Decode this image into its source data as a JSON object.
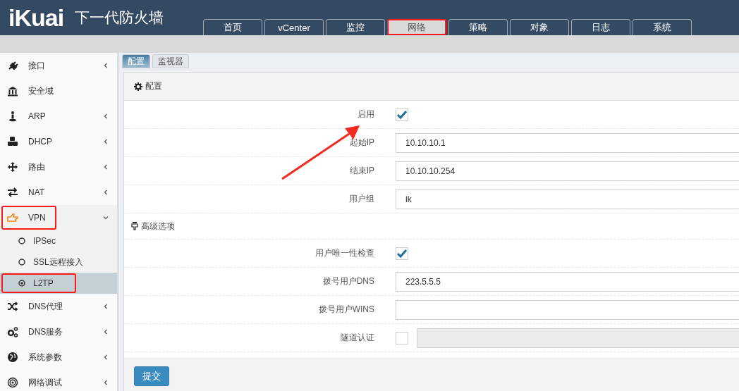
{
  "header": {
    "logo": "iKuai",
    "title": "下一代防火墙"
  },
  "nav_tabs": [
    {
      "label": "首页",
      "selected": false,
      "highlighted": false
    },
    {
      "label": "vCenter",
      "selected": false,
      "highlighted": false
    },
    {
      "label": "监控",
      "selected": false,
      "highlighted": false
    },
    {
      "label": "网络",
      "selected": true,
      "highlighted": true
    },
    {
      "label": "策略",
      "selected": false,
      "highlighted": false
    },
    {
      "label": "对象",
      "selected": false,
      "highlighted": false
    },
    {
      "label": "日志",
      "selected": false,
      "highlighted": false
    },
    {
      "label": "系统",
      "selected": false,
      "highlighted": false
    }
  ],
  "sidebar": {
    "items": [
      {
        "label": "接口",
        "expandable": true,
        "expanded": false,
        "highlighted": false
      },
      {
        "label": "安全域",
        "expandable": false,
        "expanded": false,
        "highlighted": false
      },
      {
        "label": "ARP",
        "expandable": true,
        "expanded": false,
        "highlighted": false
      },
      {
        "label": "DHCP",
        "expandable": true,
        "expanded": false,
        "highlighted": false
      },
      {
        "label": "路由",
        "expandable": true,
        "expanded": false,
        "highlighted": false
      },
      {
        "label": "NAT",
        "expandable": true,
        "expanded": false,
        "highlighted": false
      },
      {
        "label": "VPN",
        "expandable": true,
        "expanded": true,
        "highlighted": true,
        "children": [
          {
            "label": "IPSec",
            "selected": false,
            "highlighted": false
          },
          {
            "label": "SSL远程接入",
            "selected": false,
            "highlighted": false
          },
          {
            "label": "L2TP",
            "selected": true,
            "highlighted": true
          }
        ]
      },
      {
        "label": "DNS代理",
        "expandable": true,
        "expanded": false,
        "highlighted": false
      },
      {
        "label": "DNS服务",
        "expandable": true,
        "expanded": false,
        "highlighted": false
      },
      {
        "label": "系统参数",
        "expandable": true,
        "expanded": false,
        "highlighted": false
      },
      {
        "label": "网络调试",
        "expandable": true,
        "expanded": false,
        "highlighted": false
      }
    ]
  },
  "sub_tabs": [
    {
      "label": "配置",
      "selected": true
    },
    {
      "label": "监视器",
      "selected": false
    }
  ],
  "panel": {
    "title": "配置",
    "rows": [
      {
        "kind": "checkbox",
        "label": "启用",
        "checked": true
      },
      {
        "kind": "text",
        "label": "起始IP",
        "value": "10.10.10.1"
      },
      {
        "kind": "text",
        "label": "结束IP",
        "value": "10.10.10.254"
      },
      {
        "kind": "text",
        "label": "用户组",
        "value": "ik"
      },
      {
        "kind": "section",
        "label": "高级选项"
      },
      {
        "kind": "checkbox",
        "label": "用户唯一性检查",
        "checked": true
      },
      {
        "kind": "text",
        "label": "拨号用户DNS",
        "value": "223.5.5.5"
      },
      {
        "kind": "text",
        "label": "拨号用户WINS"
      },
      {
        "kind": "checkbox_field",
        "label": "隧道认证",
        "checked": false,
        "disabled": true
      }
    ],
    "submit": "提交"
  },
  "annotations": [
    {
      "kind": "arrow"
    }
  ]
}
